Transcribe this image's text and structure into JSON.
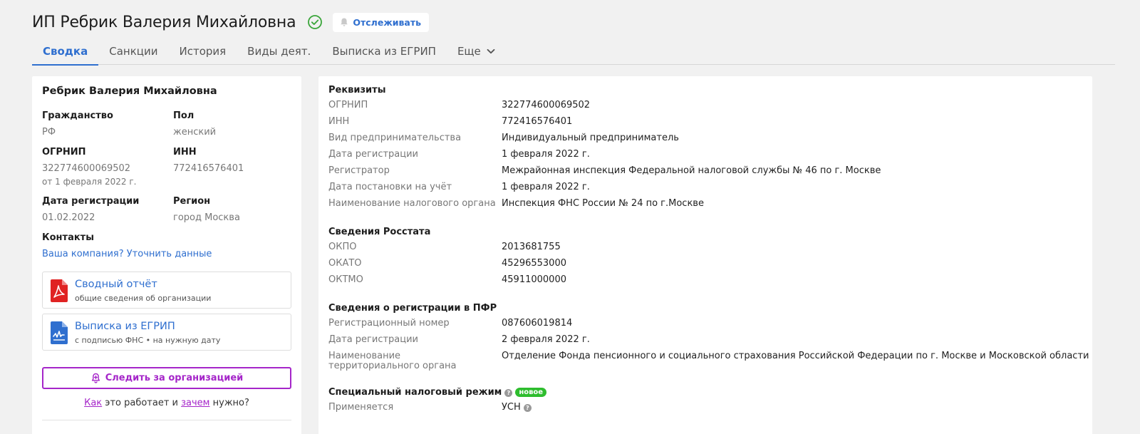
{
  "header": {
    "title": "ИП Ребрик Валерия Михайловна",
    "follow_label": "Отслеживать",
    "status_color": "#3aa53a",
    "accent_color": "#2f6fcf"
  },
  "tabs": [
    {
      "label": "Сводка",
      "active": true
    },
    {
      "label": "Санкции"
    },
    {
      "label": "История"
    },
    {
      "label": "Виды деят."
    },
    {
      "label": "Выписка из ЕГРИП"
    },
    {
      "label": "Еще"
    }
  ],
  "summary": {
    "name": "Ребрик Валерия Михайловна",
    "citizenship_label": "Гражданство",
    "citizenship_value": "РФ",
    "gender_label": "Пол",
    "gender_value": "женский",
    "ogrnip_label": "ОГРНИП",
    "ogrnip_value": "322774600069502",
    "ogrnip_date": "от 1 февраля 2022 г.",
    "inn_label": "ИНН",
    "inn_value": "772416576401",
    "regdate_label": "Дата регистрации",
    "regdate_value": "01.02.2022",
    "region_label": "Регион",
    "region_value": "город Москва",
    "contacts_label": "Контакты",
    "contacts_link": "Ваша компания? Уточнить данные",
    "report_title": "Сводный отчёт",
    "report_sub": "общие сведения об организации",
    "extract_title": "Выписка из ЕГРИП",
    "extract_sub": "с подписью ФНС • на нужную дату",
    "watch_label": "Следить за организацией",
    "how_prefix": "Как",
    "how_middle": " это работает и ",
    "how_link": "зачем",
    "how_suffix": " нужно?",
    "watch_color": "#a526c9"
  },
  "details": {
    "requisites_title": "Реквизиты",
    "requisites": [
      {
        "key": "ОГРНИП",
        "value": "322774600069502"
      },
      {
        "key": "ИНН",
        "value": "772416576401"
      },
      {
        "key": "Вид предпринимательства",
        "value": "Индивидуальный предприниматель"
      },
      {
        "key": "Дата регистрации",
        "value": "1 февраля 2022 г."
      },
      {
        "key": "Регистратор",
        "value": "Межрайонная инспекция Федеральной налоговой службы № 46 по г. Москве"
      },
      {
        "key": "Дата постановки на учёт",
        "value": "1 февраля 2022 г."
      },
      {
        "key": "Наименование налогового органа",
        "value": "Инспекция ФНС России № 24 по г.Москве"
      }
    ],
    "rosstat_title": "Сведения Росстата",
    "rosstat": [
      {
        "key": "ОКПО",
        "value": "2013681755"
      },
      {
        "key": "ОКАТО",
        "value": "45296553000"
      },
      {
        "key": "ОКТМО",
        "value": "45911000000"
      }
    ],
    "pfr_title": "Сведения о регистрации в ПФР",
    "pfr": [
      {
        "key": "Регистрационный номер",
        "value": "087606019814"
      },
      {
        "key": "Дата регистрации",
        "value": "2 февраля 2022 г."
      },
      {
        "key": "Наименование территориального органа",
        "value": "Отделение Фонда пенсионного и социального страхования Российской Федерации по г. Москве и Московской области"
      }
    ],
    "tax_title": "Специальный налоговый режим",
    "tax_badge": "новое",
    "tax_key": "Применяется",
    "tax_value": "УСН"
  }
}
